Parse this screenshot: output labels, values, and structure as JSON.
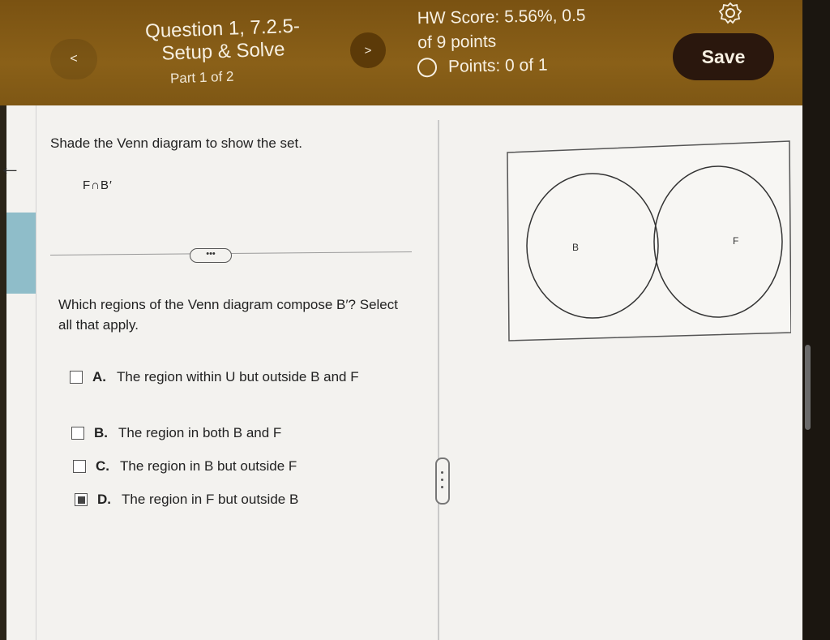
{
  "header": {
    "back_label": "<",
    "question_title": "Question 1, 7.2.5-\nSetup & Solve",
    "part": "Part 1 of 2",
    "next_label": ">",
    "hw_score": "HW Score: 5.56%, 0.5\nof 9 points",
    "points": "Points: 0 of 1",
    "save_label": "Save",
    "settings_icon": "gear-icon"
  },
  "content": {
    "instruction": "Shade the Venn diagram to show the set.",
    "set_expression": "F∩B′",
    "more_label": "•••",
    "question": "Which regions of the Venn diagram compose B′? Select all that apply.",
    "options": [
      {
        "letter": "A.",
        "text": "The region within U but outside B and F",
        "checked": false
      },
      {
        "letter": "B.",
        "text": "The region in both B and F",
        "checked": false
      },
      {
        "letter": "C.",
        "text": "The region in B but outside F",
        "checked": false
      },
      {
        "letter": "D.",
        "text": "The region in F but outside B",
        "checked": true
      }
    ]
  },
  "venn": {
    "label_left": "B",
    "label_right": "F"
  },
  "sidebar": {
    "back_arrow": "←"
  },
  "colors": {
    "header": "#7a5212",
    "save_button": "#2a170d",
    "side_tab": "#8fbdc9"
  }
}
